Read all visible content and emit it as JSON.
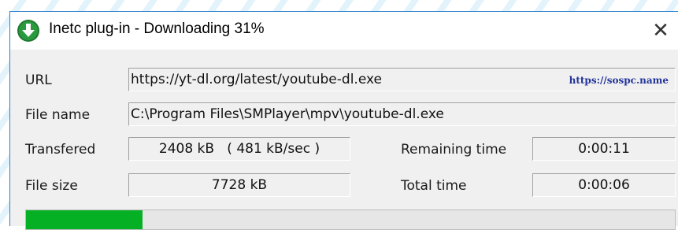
{
  "window": {
    "title": "Inetc plug-in - Downloading 31%",
    "close_glyph": "✕"
  },
  "fields": {
    "url_label": "URL",
    "url_value": "https://yt-dl.org/latest/youtube-dl.exe",
    "filename_label": "File name",
    "filename_value": "C:\\Program Files\\SMPlayer\\mpv\\youtube-dl.exe",
    "transferred_label": "Transfered",
    "transferred_value": "2408 kB   ( 481 kB/sec )",
    "remaining_label": "Remaining time",
    "remaining_value": "0:00:11",
    "filesize_label": "File size",
    "filesize_value": "7728 kB",
    "total_label": "Total time",
    "total_value": "0:00:06"
  },
  "watermark": "https://sospc.name",
  "progress": {
    "fraction": 0.18,
    "color": "#06b025"
  },
  "icons": {
    "app": "download-arrow-icon",
    "close": "close-icon"
  },
  "colors": {
    "title_border": "#2b7fc9",
    "window_bg": "#f0f0f0"
  }
}
